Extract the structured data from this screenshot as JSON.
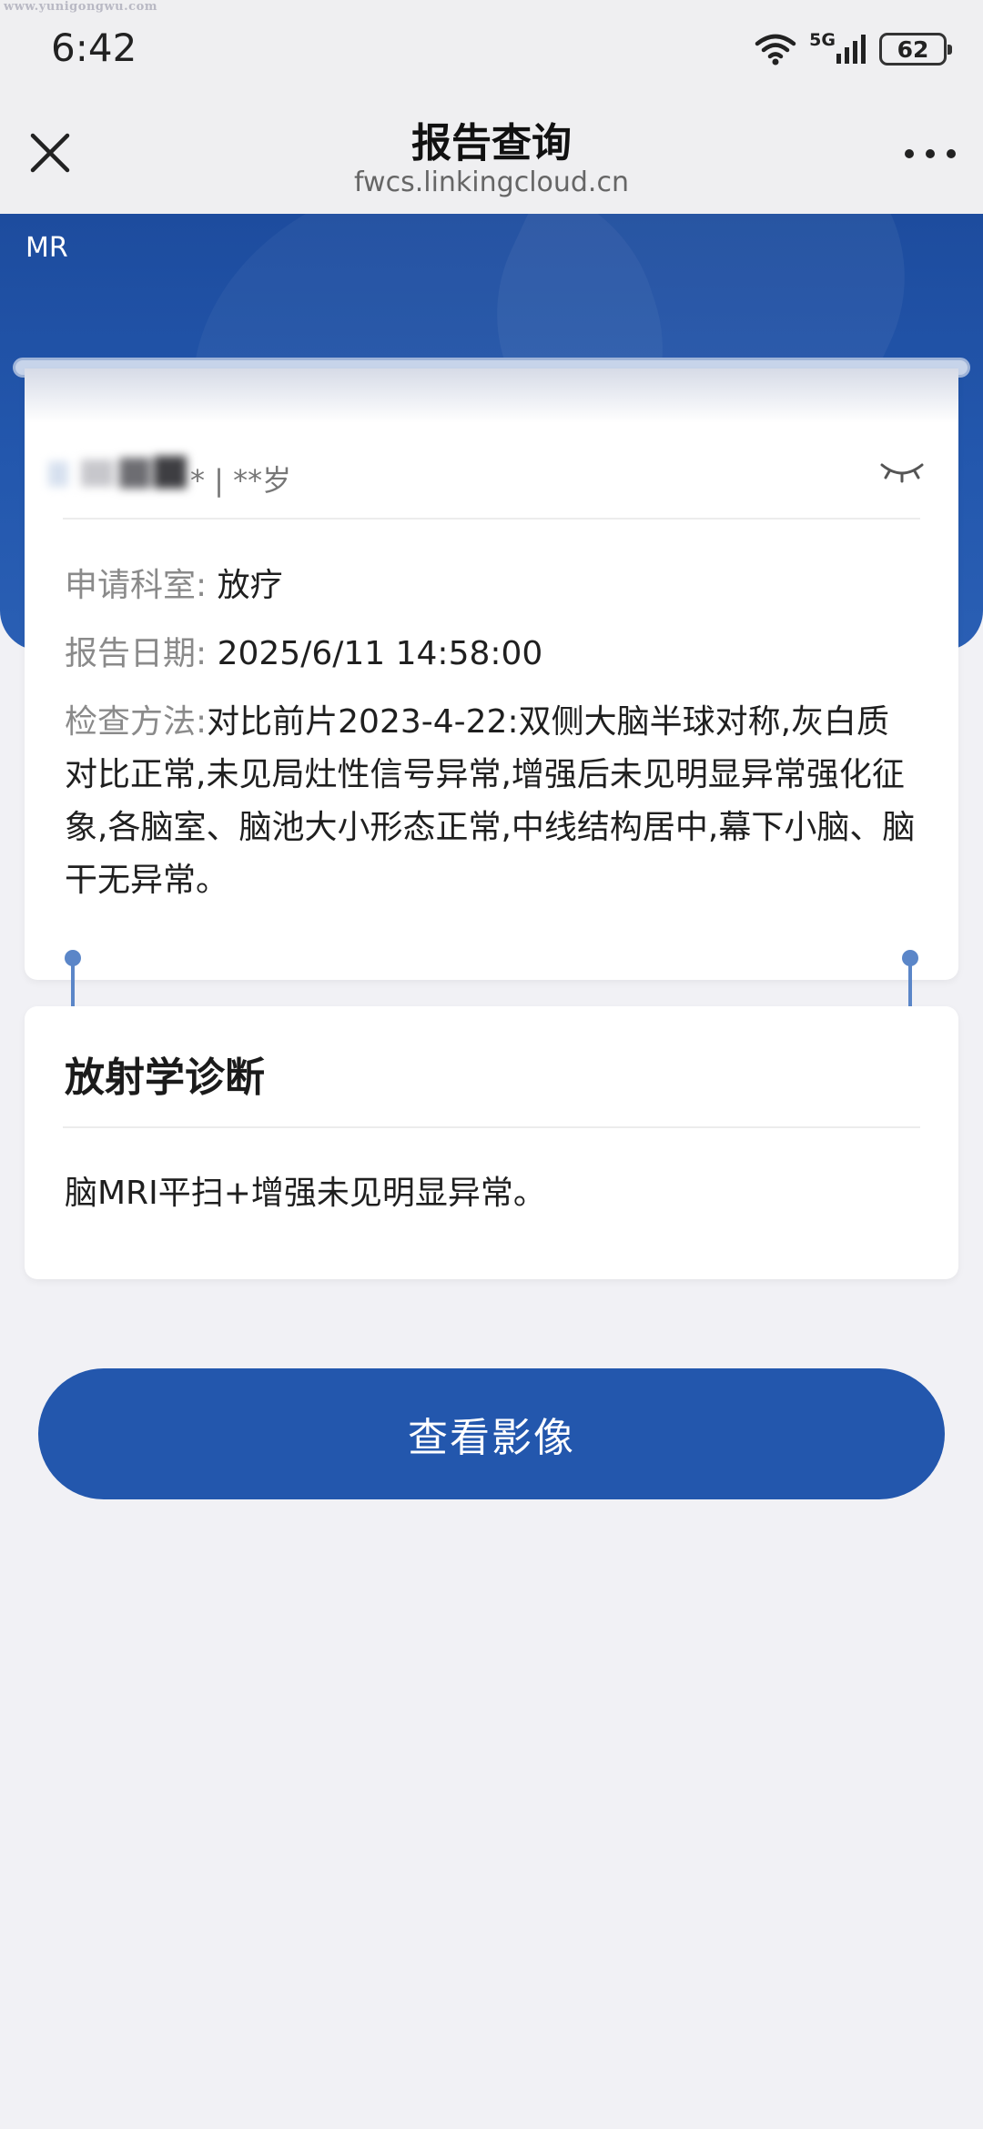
{
  "status_bar": {
    "watermark": "www.yunigongwu.com",
    "time": "6:42",
    "network_label": "5G",
    "battery_level": "62"
  },
  "nav": {
    "title": "报告查询",
    "url": "fwcs.linkingcloud.cn"
  },
  "header": {
    "exam_type": "MR"
  },
  "patient": {
    "meta": "* | **岁"
  },
  "report": {
    "dept_label": "申请科室:",
    "dept_value": "放疗",
    "date_label": "报告日期:",
    "date_value": "2025/6/11 14:58:00",
    "method_label": "检查方法:",
    "method_value": "对比前片2023-4-22:双侧大脑半球对称,灰白质对比正常,未见局灶性信号异常,增强后未见明显异常强化征象,各脑室、脑池大小形态正常,中线结构居中,幕下小脑、脑干无异常。"
  },
  "diagnosis": {
    "title": "放射学诊断",
    "text": "脑MRI平扫+增强未见明显异常。"
  },
  "actions": {
    "view_images_label": "查看影像"
  },
  "colors": {
    "primary": "#2357ad",
    "header_blue": "#1d4c9e",
    "page_bg": "#f1f1f5"
  }
}
